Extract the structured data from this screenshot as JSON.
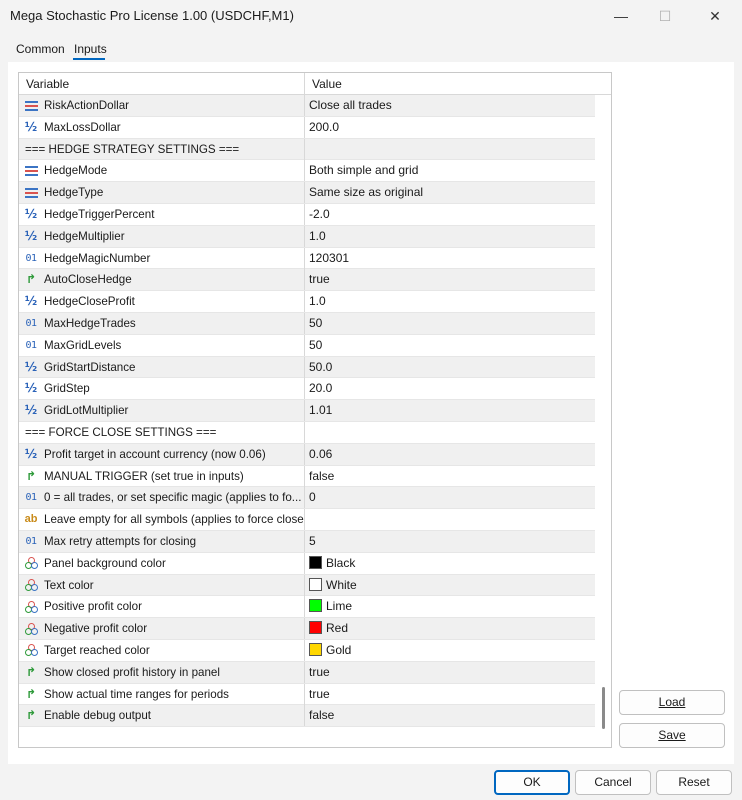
{
  "window": {
    "title": "Mega Stochastic Pro License 1.00 (USDCHF,M1)",
    "minimize_glyph": "—",
    "maximize_glyph": "☐",
    "close_glyph": "✕"
  },
  "tabs": [
    {
      "label": "Common",
      "active": false
    },
    {
      "label": "Inputs",
      "active": true
    }
  ],
  "grid": {
    "header": {
      "variable": "Variable",
      "value": "Value"
    },
    "rows": [
      {
        "type": "enum",
        "variable": "RiskActionDollar",
        "value": "Close all trades"
      },
      {
        "type": "double",
        "variable": "MaxLossDollar",
        "value": "200.0"
      },
      {
        "type": "section",
        "variable": "=== HEDGE STRATEGY SETTINGS ===",
        "value": ""
      },
      {
        "type": "enum",
        "variable": "HedgeMode",
        "value": "Both simple and grid"
      },
      {
        "type": "enum",
        "variable": "HedgeType",
        "value": "Same size as original"
      },
      {
        "type": "double",
        "variable": "HedgeTriggerPercent",
        "value": "-2.0"
      },
      {
        "type": "double",
        "variable": "HedgeMultiplier",
        "value": "1.0"
      },
      {
        "type": "int",
        "variable": "HedgeMagicNumber",
        "value": "120301"
      },
      {
        "type": "bool",
        "variable": "AutoCloseHedge",
        "value": "true"
      },
      {
        "type": "double",
        "variable": "HedgeCloseProfit",
        "value": "1.0"
      },
      {
        "type": "int",
        "variable": "MaxHedgeTrades",
        "value": "50"
      },
      {
        "type": "int",
        "variable": "MaxGridLevels",
        "value": "50"
      },
      {
        "type": "double",
        "variable": "GridStartDistance",
        "value": "50.0"
      },
      {
        "type": "double",
        "variable": "GridStep",
        "value": "20.0"
      },
      {
        "type": "double",
        "variable": "GridLotMultiplier",
        "value": "1.01"
      },
      {
        "type": "section",
        "variable": "=== FORCE CLOSE SETTINGS ===",
        "value": ""
      },
      {
        "type": "double",
        "variable": "Profit target in account currency (now 0.06)",
        "value": "0.06"
      },
      {
        "type": "bool",
        "variable": "MANUAL TRIGGER (set true in inputs)",
        "value": "false"
      },
      {
        "type": "int",
        "variable": "0 = all trades, or set specific magic (applies to fo...",
        "value": "0"
      },
      {
        "type": "string",
        "variable": "Leave empty for all symbols (applies to force close)",
        "value": ""
      },
      {
        "type": "int",
        "variable": "Max retry attempts for closing",
        "value": "5"
      },
      {
        "type": "color",
        "variable": "Panel background color",
        "value": "Black",
        "color": "#000000"
      },
      {
        "type": "color",
        "variable": "Text color",
        "value": "White",
        "color": "#ffffff"
      },
      {
        "type": "color",
        "variable": "Positive profit color",
        "value": "Lime",
        "color": "#00ff00"
      },
      {
        "type": "color",
        "variable": "Negative profit color",
        "value": "Red",
        "color": "#ff0000"
      },
      {
        "type": "color",
        "variable": "Target reached color",
        "value": "Gold",
        "color": "#ffd700"
      },
      {
        "type": "bool",
        "variable": "Show closed profit history in panel",
        "value": "true"
      },
      {
        "type": "bool",
        "variable": "Show actual time ranges for periods",
        "value": "true"
      },
      {
        "type": "bool",
        "variable": "Enable debug output",
        "value": "false"
      }
    ]
  },
  "icons": {
    "enum": "enum-icon",
    "double": "double-icon",
    "int": "integer-icon",
    "bool": "bool-icon",
    "string": "string-icon",
    "color": "color-icon"
  },
  "side_buttons": {
    "load": "Load",
    "save": "Save"
  },
  "footer_buttons": {
    "ok": "OK",
    "cancel": "Cancel",
    "reset": "Reset"
  },
  "colors": {
    "accent": "#0067c0"
  }
}
